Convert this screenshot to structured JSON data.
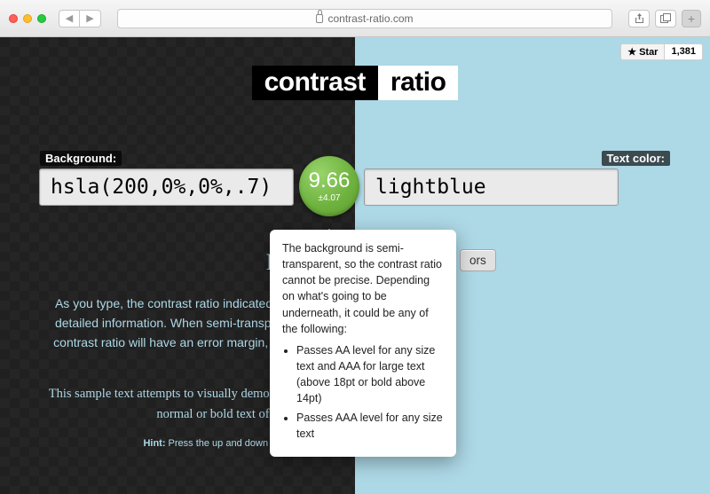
{
  "browser": {
    "url": "contrast-ratio.com",
    "star_label": "Star",
    "star_count": "1,381"
  },
  "title": {
    "word1": "contrast",
    "word2": "ratio"
  },
  "labels": {
    "bg": "Background:",
    "fg": "Text color:"
  },
  "inputs": {
    "bg": "hsla(200,0%,0%,.7)",
    "fg": "lightblue"
  },
  "ratio": {
    "value": "9.66",
    "error": "±4.07"
  },
  "swap_button": "ors",
  "tooltip": {
    "intro": "The background is semi-transparent, so the contrast ratio cannot be precise. Depending on what's going to be underneath, it could be any of the following:",
    "bullets": [
      "Passes AA level for any size text and AAA for large text (above 18pt or bold above 14pt)",
      "Passes AAA level for any size text"
    ]
  },
  "body": {
    "heading": "How",
    "p1": "As you type, the contrast ratio indicated will update. Hover over the circle to get more detailed information. When semi-transparent colors are involved as backgrounds, the contrast ratio will have an error margin, to account for the different colors they may be over.",
    "p2": "This sample text attempts to visually demonstrate how readable this color combination is, for normal or bold text of various sizes and font styles.",
    "hint_label": "Hint:",
    "hint_text": " Press the up and down keyboard arrows while over a number"
  }
}
